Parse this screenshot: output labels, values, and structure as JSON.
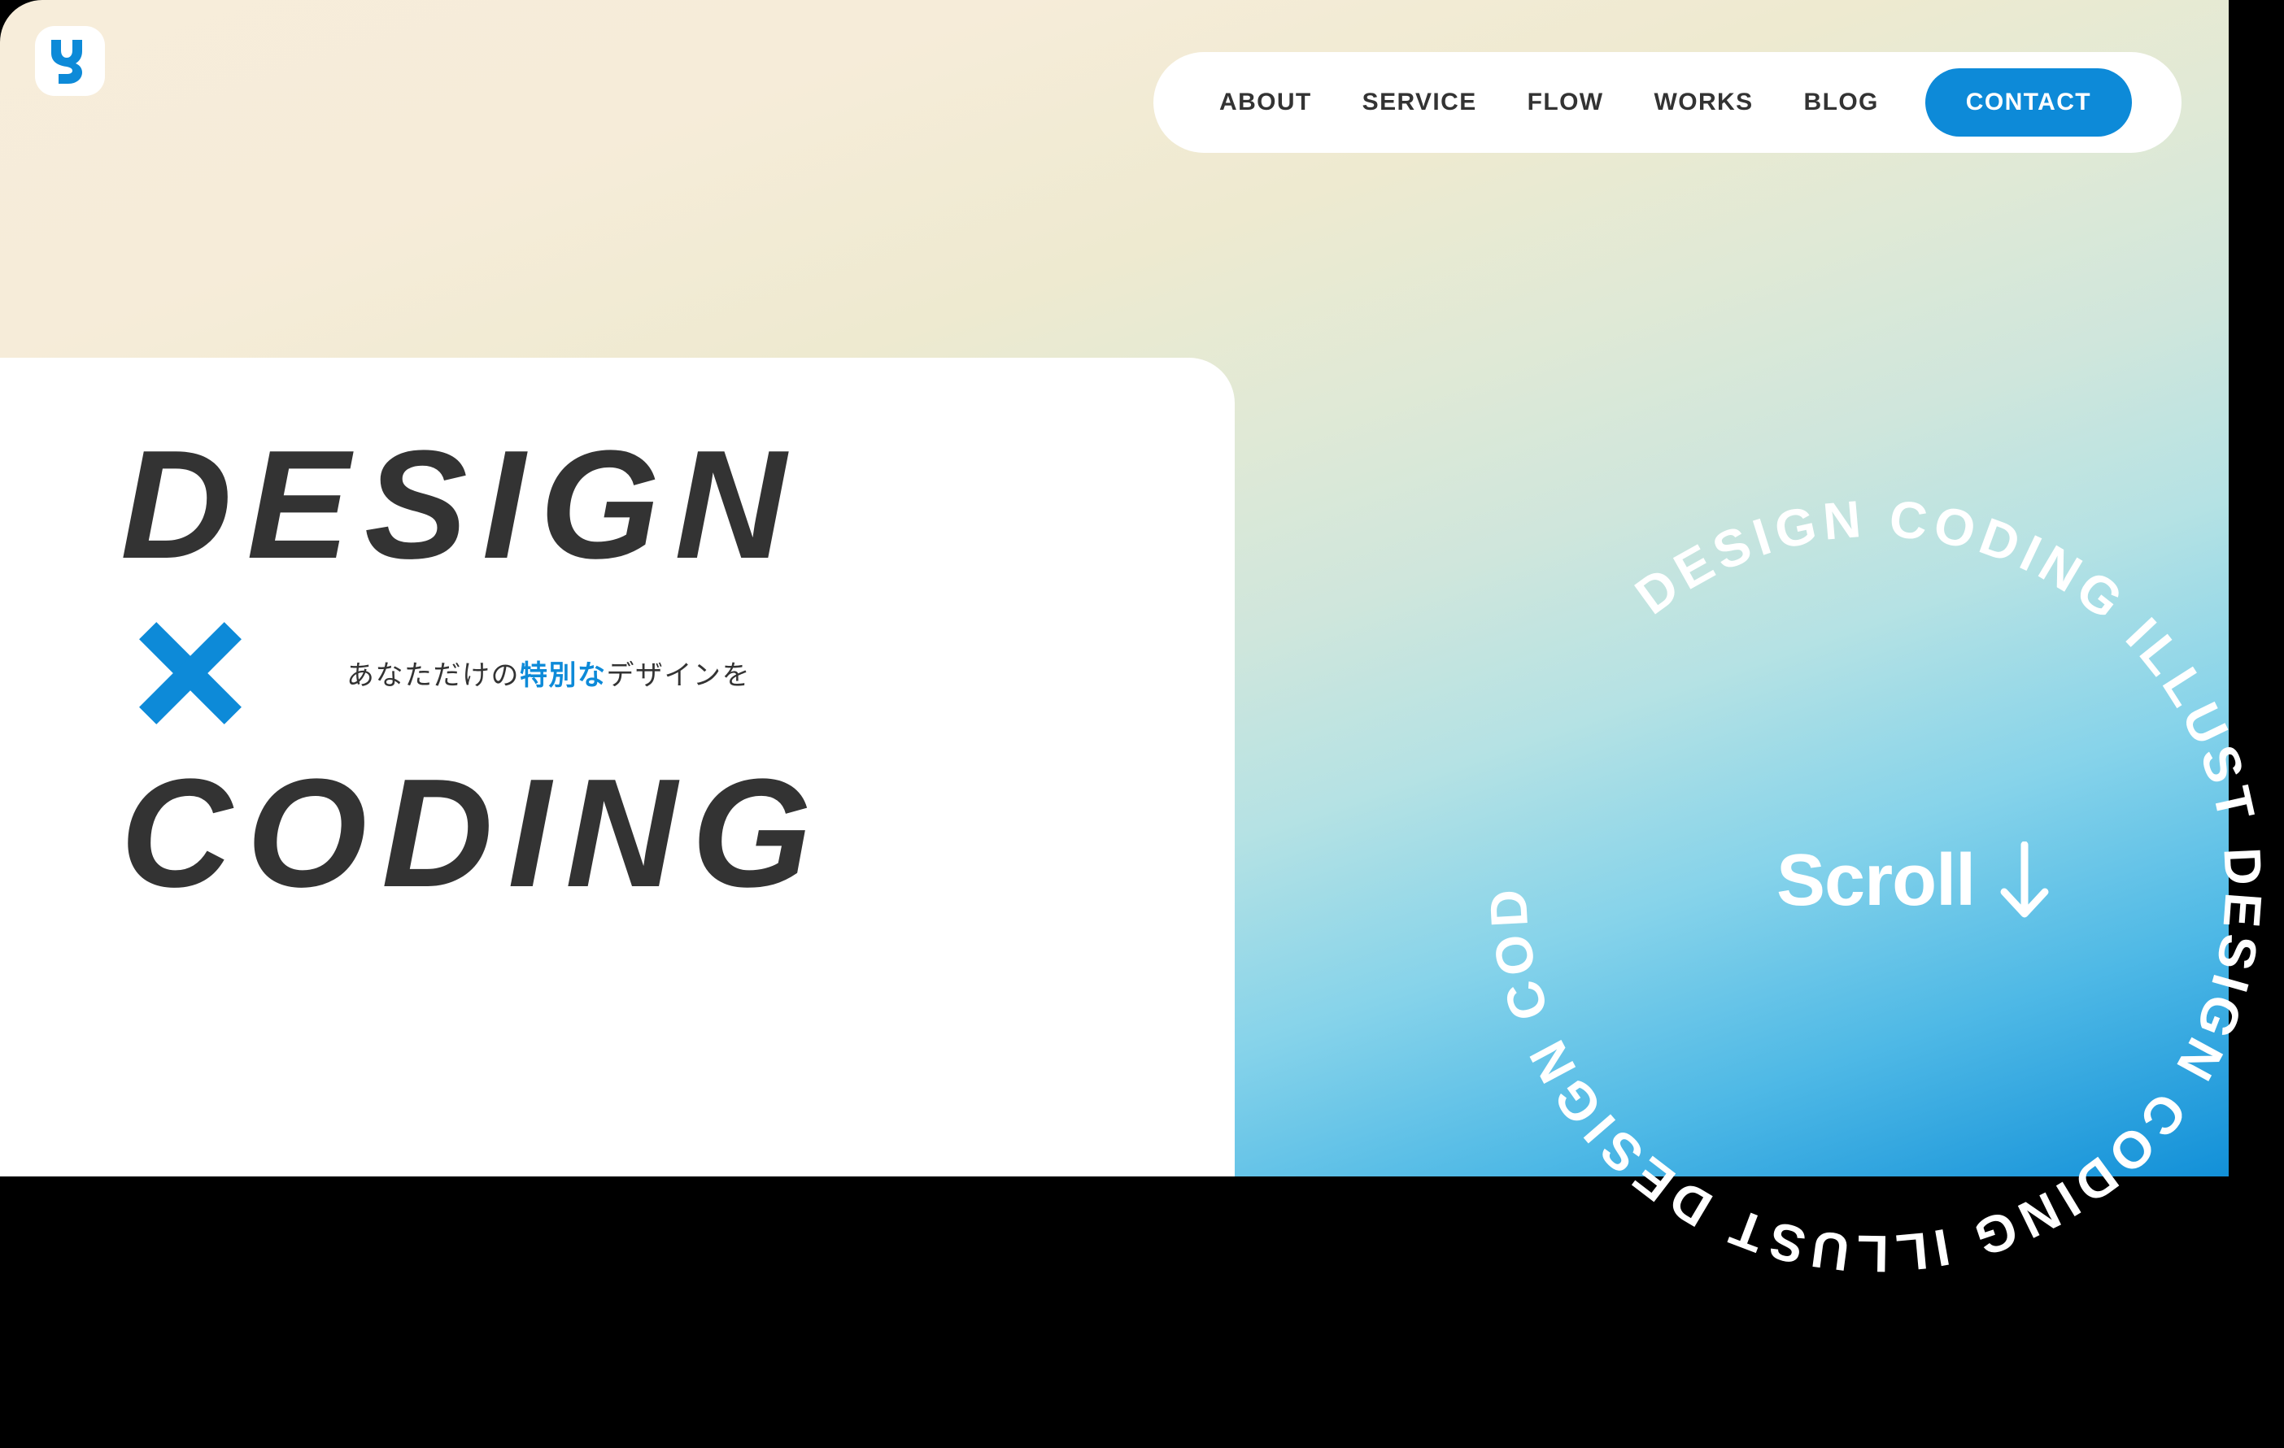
{
  "brand": {
    "logo_icon": "letter-y-logo-icon",
    "accent_color": "#0d8ad8",
    "dark_text_color": "#333333",
    "cream_color": "#f7edda"
  },
  "nav": {
    "items": [
      {
        "label": "ABOUT"
      },
      {
        "label": "SERVICE"
      },
      {
        "label": "FLOW"
      },
      {
        "label": "WORKS"
      },
      {
        "label": "BLOG"
      }
    ],
    "cta": {
      "label": "CONTACT"
    }
  },
  "hero": {
    "line1": "DESIGN",
    "separator_icon": "cross-x-icon",
    "line2": "CODING",
    "tagline_pre": "あなただけの",
    "tagline_accent": "特別な",
    "tagline_post": "デザインを"
  },
  "scroll": {
    "label": "Scroll",
    "arrow_icon": "arrow-down-icon"
  },
  "rotating_badge": {
    "text": "DESIGN CODING ILLUST DESIGN CODING ILLUST DESIGN CODING ILLUST",
    "words": [
      "DESIGN",
      "CODING",
      "ILLUST"
    ]
  }
}
